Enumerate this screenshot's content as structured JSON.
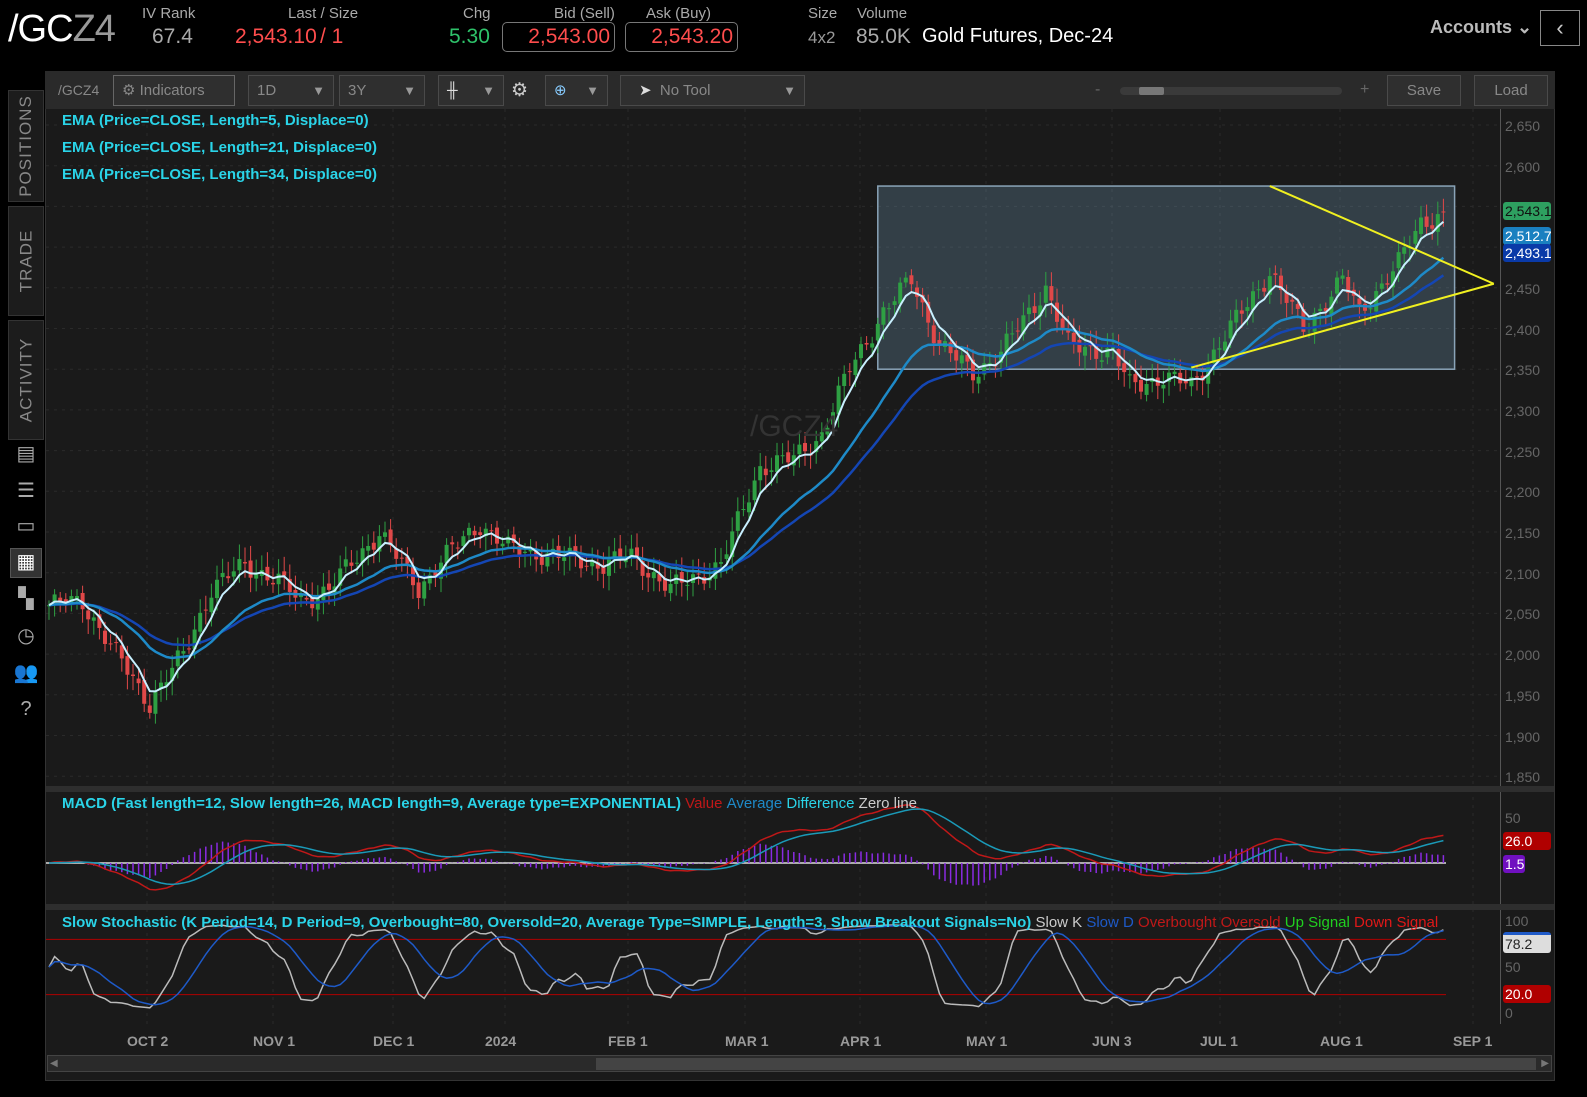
{
  "header": {
    "symbol_main": "/GC",
    "symbol_suffix": "Z4",
    "iv_rank_label": "IV Rank",
    "iv_rank": "67.4",
    "last_label": "Last / Size",
    "last": "2,543.10",
    "size": "/ 1",
    "chg_label": "Chg",
    "chg": "5.30",
    "bid_label": "Bid (Sell)",
    "bid": "2,543.00",
    "ask_label": "Ask (Buy)",
    "ask": "2,543.20",
    "size_label": "Size",
    "size_val": "4x2",
    "volume_label": "Volume",
    "volume": "85.0K",
    "description": "Gold Futures, Dec-24",
    "accounts": "Accounts"
  },
  "sidebar": {
    "tabs": [
      "POSITIONS",
      "TRADE",
      "ACTIVITY"
    ]
  },
  "toolbar": {
    "symbol": "/GCZ4",
    "indicators": "Indicators",
    "aggregation": "1D",
    "timeframe": "3Y",
    "tool": "No Tool",
    "zoom_minus": "-",
    "zoom_plus": "+",
    "zoom_fraction": 0.12,
    "save": "Save",
    "load": "Load"
  },
  "legends": {
    "ema5": "EMA (Price=CLOSE, Length=5, Displace=0)",
    "ema21": "EMA (Price=CLOSE, Length=21, Displace=0)",
    "ema34": "EMA (Price=CLOSE, Length=34, Displace=0)",
    "macd": "MACD (Fast length=12, Slow length=26, MACD length=9, Average type=EXPONENTIAL)",
    "macd_items": [
      "Value",
      "Average",
      "Difference",
      "Zero line"
    ],
    "stoch": "Slow Stochastic (K Period=14, D Period=9, Overbought=80, Oversold=20, Average Type=SIMPLE, Length=3, Show Breakout Signals=No)",
    "stoch_items": [
      "Slow K",
      "Slow D",
      "Overbought",
      "Oversold",
      "Up Signal",
      "Down Signal"
    ]
  },
  "watermark": "/GCZ4",
  "price_axis": [
    "2,650",
    "2,600",
    "2,550",
    "2,500",
    "2,450",
    "2,400",
    "2,350",
    "2,300",
    "2,250",
    "2,200",
    "2,150",
    "2,100",
    "2,050",
    "2,000",
    "1,950",
    "1,900",
    "1,850"
  ],
  "price_tags": {
    "last": "2,543.1",
    "ema21": "2,512.7",
    "ema34": "2,493.1"
  },
  "macd_axis": [
    "50"
  ],
  "macd_tags": {
    "value": "26.0",
    "diff": "1.5"
  },
  "stoch_axis": [
    "100",
    "50",
    "0"
  ],
  "stoch_tags": {
    "k": "78.2",
    "oversold": "20.0"
  },
  "date_axis": [
    "OCT 2",
    "NOV 1",
    "DEC 1",
    "2024",
    "FEB 1",
    "MAR 1",
    "APR 1",
    "MAY 1",
    "JUN 3",
    "JUL 1",
    "AUG 1",
    "SEP 1"
  ],
  "colors": {
    "up": "#2ea043",
    "down": "#e04848",
    "ema5": "#c8f0ff",
    "ema21": "#1e8ac8",
    "ema34": "#1446b4",
    "trend": "#f0f020"
  },
  "chart_data": {
    "type": "candlestick",
    "ylim": [
      1850,
      2650
    ],
    "bars": 250,
    "close_waypoints": [
      [
        0,
        2060
      ],
      [
        6,
        2065
      ],
      [
        11,
        2010
      ],
      [
        18,
        1940
      ],
      [
        24,
        2000
      ],
      [
        29,
        2080
      ],
      [
        35,
        2110
      ],
      [
        41,
        2090
      ],
      [
        45,
        2065
      ],
      [
        50,
        2080
      ],
      [
        59,
        2150
      ],
      [
        66,
        2080
      ],
      [
        70,
        2115
      ],
      [
        77,
        2160
      ],
      [
        82,
        2130
      ],
      [
        91,
        2120
      ],
      [
        99,
        2110
      ],
      [
        104,
        2120
      ],
      [
        111,
        2080
      ],
      [
        120,
        2110
      ],
      [
        127,
        2230
      ],
      [
        133,
        2240
      ],
      [
        138,
        2270
      ],
      [
        143,
        2350
      ],
      [
        149,
        2420
      ],
      [
        154,
        2460
      ],
      [
        159,
        2380
      ],
      [
        165,
        2345
      ],
      [
        170,
        2370
      ],
      [
        178,
        2450
      ],
      [
        182,
        2380
      ],
      [
        190,
        2370
      ],
      [
        193,
        2330
      ],
      [
        199,
        2340
      ],
      [
        204,
        2330
      ],
      [
        211,
        2400
      ],
      [
        218,
        2470
      ],
      [
        224,
        2400
      ],
      [
        231,
        2460
      ],
      [
        234,
        2420
      ],
      [
        241,
        2480
      ],
      [
        245,
        2530
      ],
      [
        249,
        2543
      ]
    ],
    "range_box": {
      "low": 2350,
      "high": 2575,
      "start_bar": 148,
      "end_bar": 251
    },
    "triangle": {
      "upper": [
        [
          218,
          2575
        ],
        [
          258,
          2455
        ]
      ],
      "lower": [
        [
          204,
          2352
        ],
        [
          258,
          2455
        ]
      ]
    }
  }
}
